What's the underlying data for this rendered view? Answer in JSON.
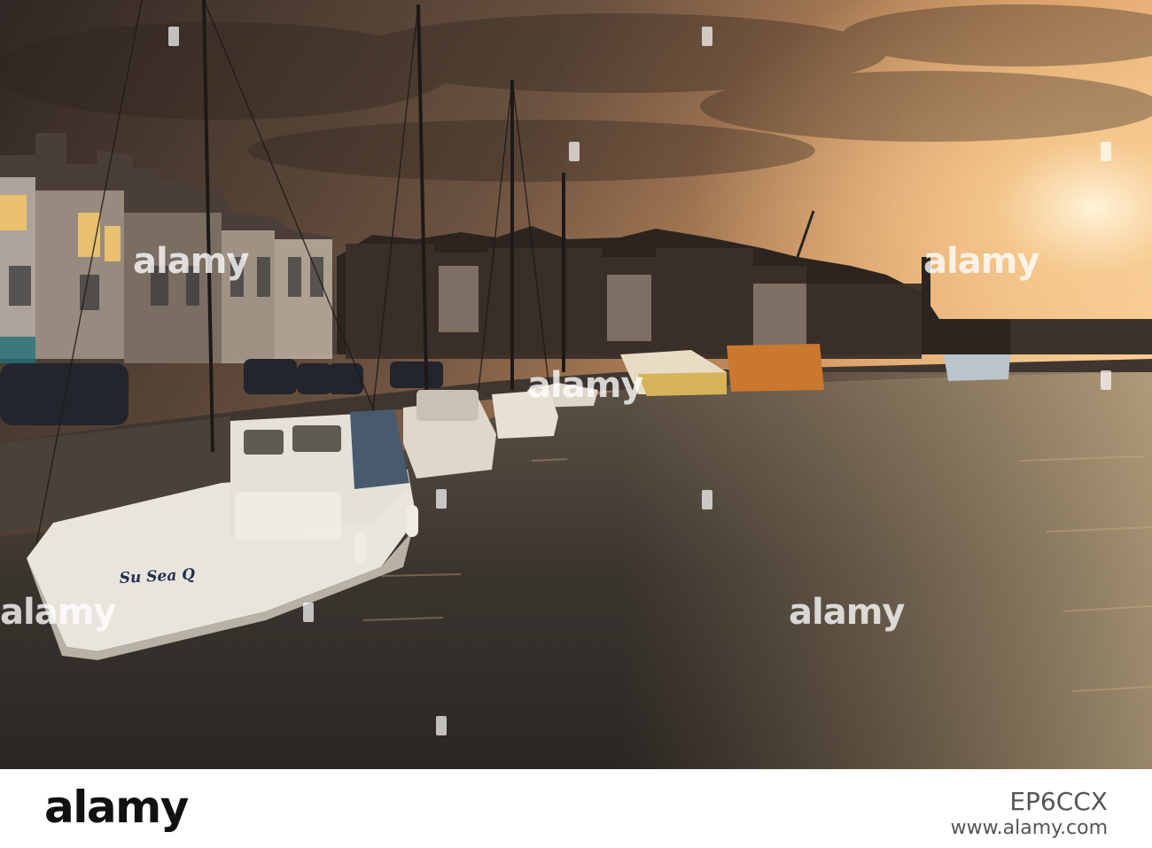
{
  "photo": {
    "scene": "harbour-at-sunset",
    "boat_name": "Su Sea Q",
    "colors": {
      "sky_top": "#3b2f28",
      "sky_glow": "#f6c08a",
      "water": "#3e3a35",
      "boats": "#e8e4dc"
    }
  },
  "watermarks": [
    "alamy",
    "alamy",
    "alamy",
    "alamy",
    "alamy",
    "alamy",
    "alamy",
    "alamy",
    "alamy"
  ],
  "footer": {
    "logo": "alamy",
    "image_id": "EP6CCX",
    "url": "www.alamy.com"
  }
}
